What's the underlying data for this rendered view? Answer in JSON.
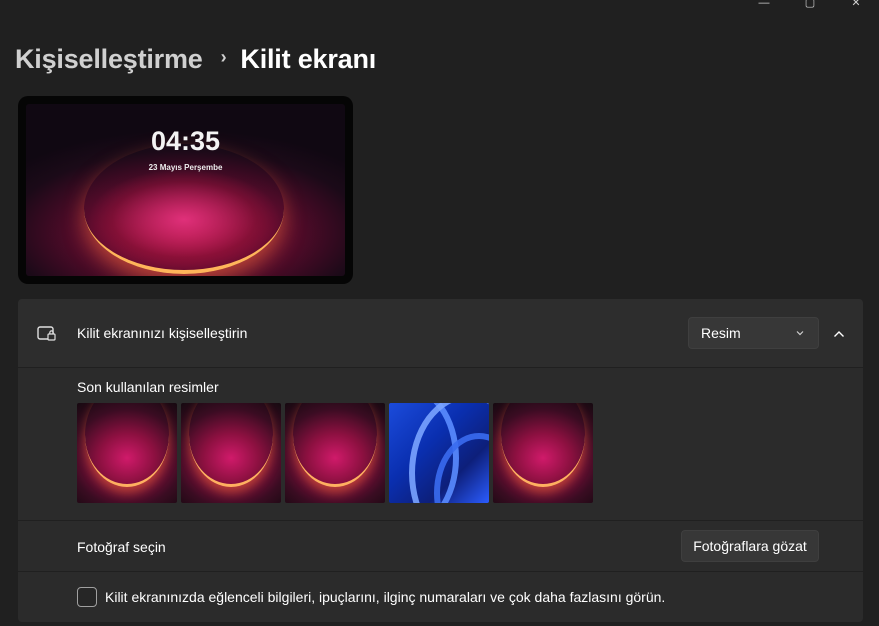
{
  "window": {
    "controls": [
      "minimize",
      "maximize",
      "close"
    ]
  },
  "breadcrumb": {
    "parent": "Kişiselleştirme",
    "separator": "›",
    "current": "Kilit ekranı"
  },
  "preview": {
    "time": "04:35",
    "date": "23 Mayıs Perşembe"
  },
  "personalize": {
    "icon": "lock-screen-icon",
    "label": "Kilit ekranınızı kişiselleştirin",
    "selected_option": "Resim",
    "expanded": true
  },
  "recent": {
    "label": "Son kullanılan resimler",
    "images": [
      {
        "style": "bloom-red"
      },
      {
        "style": "bloom-red"
      },
      {
        "style": "bloom-red"
      },
      {
        "style": "bloom-blue"
      },
      {
        "style": "bloom-red"
      }
    ]
  },
  "photo": {
    "label": "Fotoğraf seçin",
    "browse_label": "Fotoğraflara gözat"
  },
  "tips": {
    "checked": false,
    "label": "Kilit ekranınızda eğlenceli bilgileri, ipuçlarını, ilginç numaraları ve çok daha fazlasını görün."
  },
  "colors": {
    "background": "#202020",
    "card": "#2b2b2b",
    "control": "#373737"
  }
}
